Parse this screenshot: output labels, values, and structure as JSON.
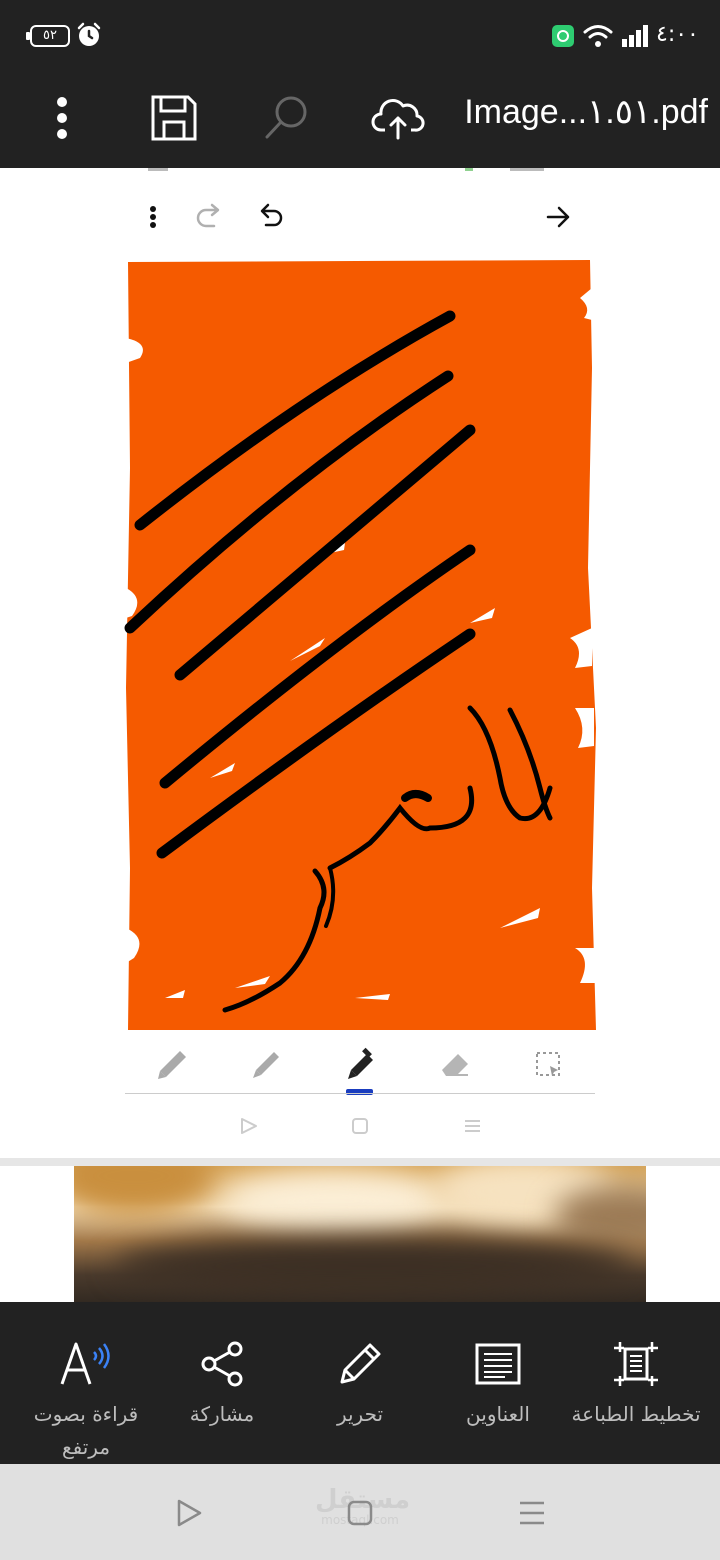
{
  "status_bar": {
    "battery": "٥٢",
    "time": "٤:٠٠"
  },
  "toolbar": {
    "title": "Image...١.٥١.pdf",
    "icons": [
      "more-vert-icon",
      "save-icon",
      "search-icon",
      "cloud-upload-icon"
    ]
  },
  "embedded_screenshot": {
    "top_icons": [
      "more-vert-icon",
      "redo-icon",
      "undo-icon",
      "forward-arrow-icon"
    ],
    "canvas_fill_color": "#f55a00",
    "stroke_color": "#000000",
    "tools": [
      "highlighter-icon",
      "pencil-icon",
      "pen-icon",
      "eraser-icon",
      "lasso-select-icon"
    ],
    "selected_tool_index": 2,
    "selected_indicator_color": "#1a3dbf",
    "nav_icons": [
      "back-icon",
      "home-icon",
      "recents-icon"
    ]
  },
  "actions": [
    {
      "label": "قراءة بصوت مرتفع",
      "icon": "read-aloud-icon"
    },
    {
      "label": "مشاركة",
      "icon": "share-icon"
    },
    {
      "label": "تحرير",
      "icon": "pencil-icon"
    },
    {
      "label": "العناوين",
      "icon": "headings-icon"
    },
    {
      "label": "تخطيط الطباعة",
      "icon": "print-layout-icon"
    }
  ],
  "watermark": {
    "name": "مستقل",
    "url": "mostaql.com"
  },
  "sys_nav": [
    "back-icon",
    "home-icon",
    "recents-icon"
  ]
}
